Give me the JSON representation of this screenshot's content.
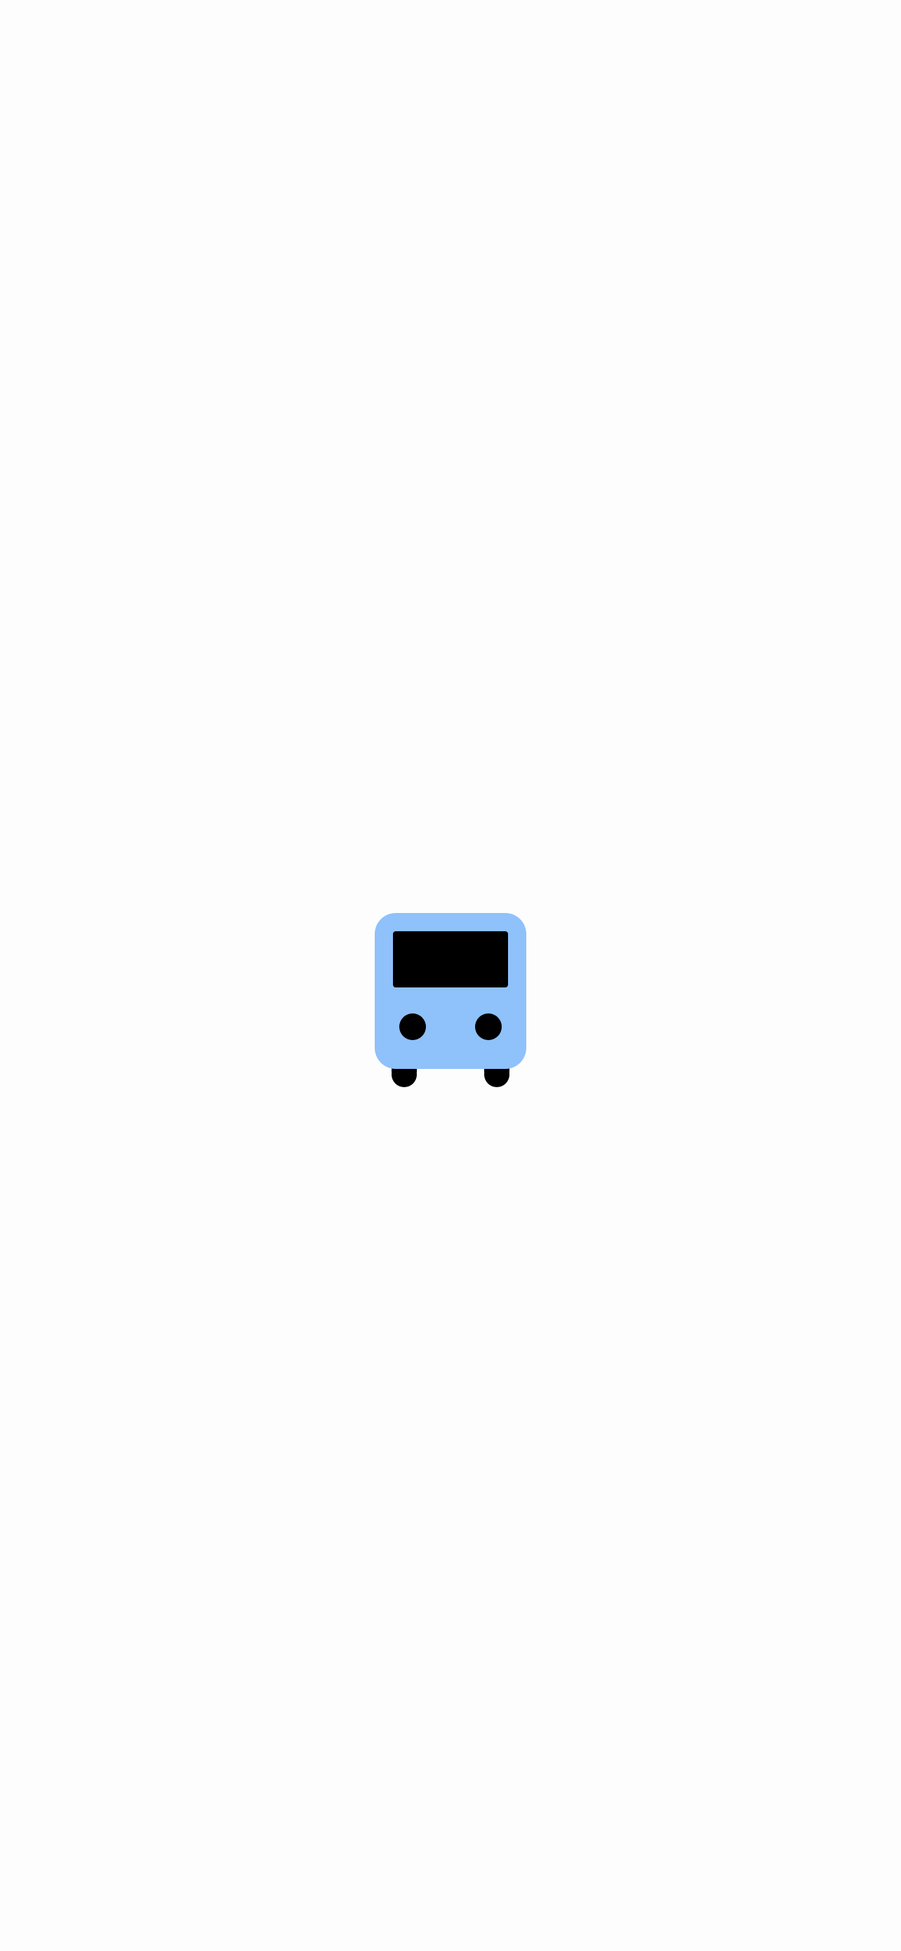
{
  "splash": {
    "background_color": "#fdfdfd",
    "logo": {
      "icon": "bus-icon",
      "body_color": "#8fc1fb",
      "detail_color": "#000000"
    }
  }
}
